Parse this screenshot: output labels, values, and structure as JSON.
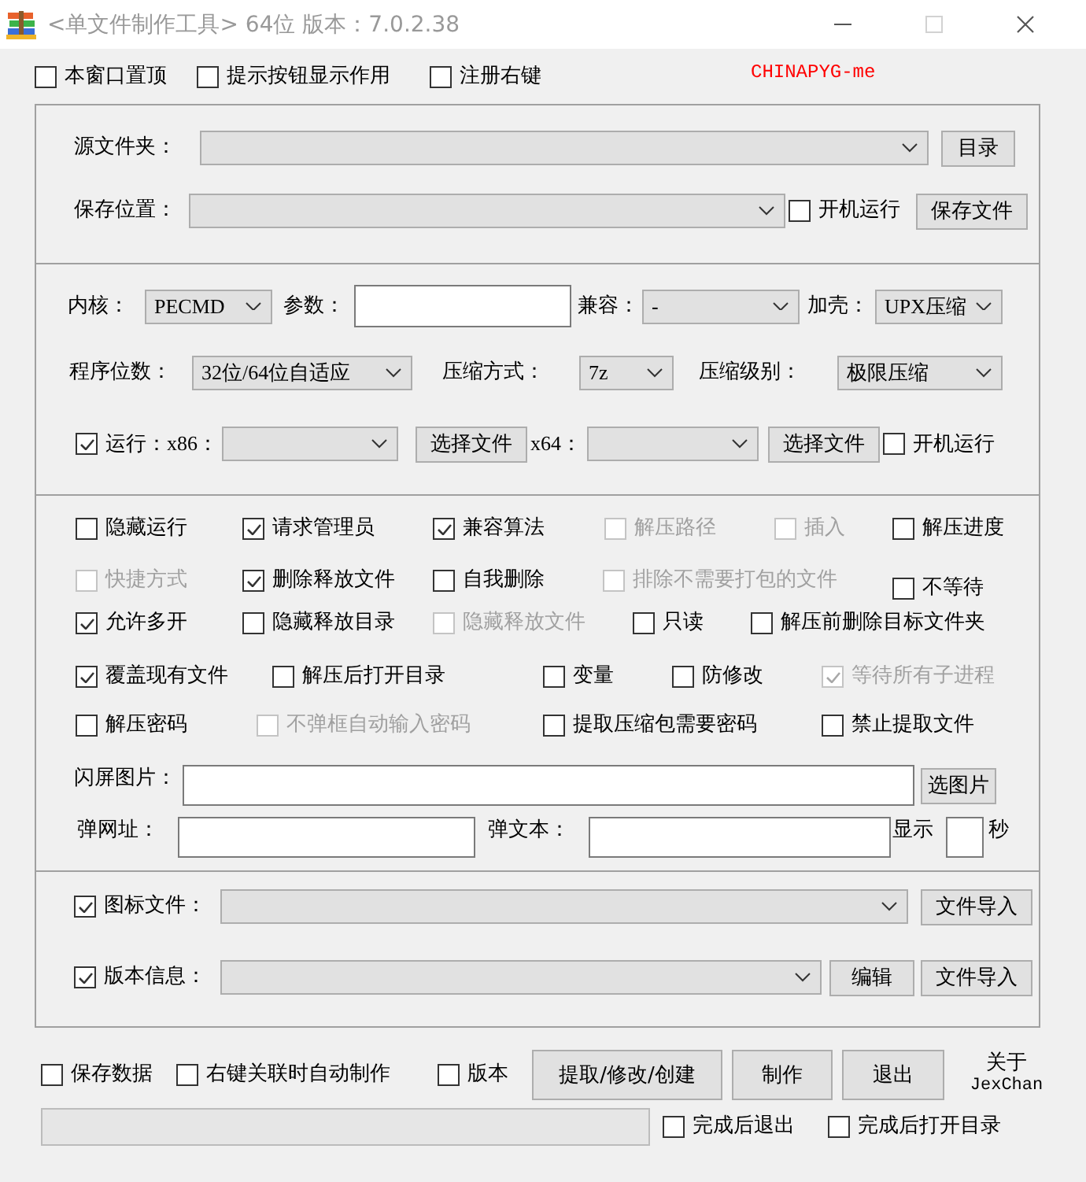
{
  "window": {
    "title": "<单文件制作工具> 64位 版本：7.0.2.38",
    "controls": [
      {
        "kind": "minimize",
        "disabled": false
      },
      {
        "kind": "maximize",
        "disabled": true
      },
      {
        "kind": "close",
        "disabled": false
      }
    ]
  },
  "top_bar": {
    "options": [
      {
        "label": "本窗口置顶",
        "checked": false,
        "disabled": false
      },
      {
        "label": "提示按钮显示作用",
        "checked": false,
        "disabled": false
      },
      {
        "label": "注册右键",
        "checked": false,
        "disabled": false
      }
    ],
    "tag": "CHINAPYG-me"
  },
  "panel": {
    "sections": [
      {
        "rows": [
          {
            "items": [
              {
                "kind": "label",
                "text": "源文件夹："
              },
              {
                "kind": "dropdown"
              },
              {
                "kind": "button",
                "label": "目录"
              }
            ]
          },
          {
            "items": [
              {
                "kind": "label",
                "text": "保存位置："
              },
              {
                "kind": "dropdown"
              },
              {
                "kind": "checkbox",
                "label": "开机运行",
                "checked": false,
                "disabled": false
              },
              {
                "kind": "button",
                "label": "保存文件"
              }
            ]
          }
        ]
      },
      {
        "rows": [
          {
            "items": [
              {
                "kind": "label",
                "text": "内核："
              },
              {
                "kind": "dropdown",
                "value": "PECMD"
              },
              {
                "kind": "label",
                "text": "参数："
              },
              {
                "kind": "input"
              },
              {
                "kind": "label",
                "text": "兼容："
              },
              {
                "kind": "dropdown",
                "value": "-"
              },
              {
                "kind": "label",
                "text": "加壳："
              },
              {
                "kind": "dropdown",
                "value": "UPX压缩"
              }
            ]
          },
          {
            "items": [
              {
                "kind": "label",
                "text": "程序位数："
              },
              {
                "kind": "dropdown",
                "value": "32位/64位自适应"
              },
              {
                "kind": "label",
                "text": "压缩方式："
              },
              {
                "kind": "dropdown",
                "value": "7z"
              },
              {
                "kind": "label",
                "text": "压缩级别："
              },
              {
                "kind": "dropdown",
                "value": "极限压缩"
              }
            ]
          },
          {
            "items": [
              {
                "kind": "checkbox",
                "label": "运行：x86：",
                "checked": true,
                "disabled": false
              },
              {
                "kind": "dropdown"
              },
              {
                "kind": "button",
                "label": "选择文件"
              },
              {
                "kind": "label",
                "text": "x64："
              },
              {
                "kind": "dropdown"
              },
              {
                "kind": "button",
                "label": "选择文件"
              },
              {
                "kind": "checkbox",
                "label": "开机运行",
                "checked": false,
                "disabled": false
              }
            ]
          }
        ]
      },
      {
        "rows": [
          {
            "items": [
              {
                "kind": "checkbox",
                "label": "隐藏运行",
                "checked": false,
                "disabled": false
              },
              {
                "kind": "checkbox",
                "label": "请求管理员",
                "checked": true,
                "disabled": false
              },
              {
                "kind": "checkbox",
                "label": "兼容算法",
                "checked": true,
                "disabled": false
              },
              {
                "kind": "checkbox",
                "label": "解压路径",
                "checked": false,
                "disabled": true
              },
              {
                "kind": "checkbox",
                "label": "插入",
                "checked": false,
                "disabled": true
              },
              {
                "kind": "checkbox",
                "label": "解压进度",
                "checked": false,
                "disabled": false
              }
            ]
          },
          {
            "items": [
              {
                "kind": "checkbox",
                "label": "快捷方式",
                "checked": false,
                "disabled": true
              },
              {
                "kind": "checkbox",
                "label": "删除释放文件",
                "checked": true,
                "disabled": false
              },
              {
                "kind": "checkbox",
                "label": "自我删除",
                "checked": false,
                "disabled": false
              },
              {
                "kind": "checkbox",
                "label": "排除不需要打包的文件",
                "checked": false,
                "disabled": true
              },
              {
                "kind": "checkbox",
                "label": "不等待",
                "checked": false,
                "disabled": false
              }
            ]
          },
          {
            "items": [
              {
                "kind": "checkbox",
                "label": "允许多开",
                "checked": true,
                "disabled": false
              },
              {
                "kind": "checkbox",
                "label": "隐藏释放目录",
                "checked": false,
                "disabled": false
              },
              {
                "kind": "checkbox",
                "label": "隐藏释放文件",
                "checked": false,
                "disabled": true
              },
              {
                "kind": "checkbox",
                "label": "只读",
                "checked": false,
                "disabled": false
              },
              {
                "kind": "checkbox",
                "label": "解压前删除目标文件夹",
                "checked": false,
                "disabled": false
              }
            ]
          },
          {
            "items": [
              {
                "kind": "checkbox",
                "label": "覆盖现有文件",
                "checked": true,
                "disabled": false
              },
              {
                "kind": "checkbox",
                "label": "解压后打开目录",
                "checked": false,
                "disabled": false
              },
              {
                "kind": "checkbox",
                "label": "变量",
                "checked": false,
                "disabled": false
              },
              {
                "kind": "checkbox",
                "label": "防修改",
                "checked": false,
                "disabled": false
              },
              {
                "kind": "checkbox",
                "label": "等待所有子进程",
                "checked": true,
                "disabled": true
              }
            ]
          },
          {
            "items": [
              {
                "kind": "checkbox",
                "label": "解压密码",
                "checked": false,
                "disabled": false
              },
              {
                "kind": "checkbox",
                "label": "不弹框自动输入密码",
                "checked": false,
                "disabled": true
              },
              {
                "kind": "checkbox",
                "label": "提取压缩包需要密码",
                "checked": false,
                "disabled": false
              },
              {
                "kind": "checkbox",
                "label": "禁止提取文件",
                "checked": false,
                "disabled": false
              }
            ]
          },
          {
            "items": [
              {
                "kind": "label",
                "text": "闪屏图片："
              },
              {
                "kind": "input"
              },
              {
                "kind": "button",
                "label": "选图片"
              }
            ]
          },
          {
            "items": [
              {
                "kind": "label",
                "text": "弹网址："
              },
              {
                "kind": "input"
              },
              {
                "kind": "label",
                "text": "弹文本："
              },
              {
                "kind": "input"
              },
              {
                "kind": "label",
                "text": "显示"
              },
              {
                "kind": "input"
              },
              {
                "kind": "label",
                "text": "秒"
              }
            ]
          }
        ]
      },
      {
        "rows": [
          {
            "items": [
              {
                "kind": "checkbox",
                "label": "图标文件：",
                "checked": true,
                "disabled": false
              },
              {
                "kind": "dropdown"
              },
              {
                "kind": "button",
                "label": "文件导入"
              }
            ]
          },
          {
            "items": [
              {
                "kind": "checkbox",
                "label": "版本信息：",
                "checked": true,
                "disabled": false
              },
              {
                "kind": "dropdown"
              },
              {
                "kind": "button",
                "label": "编辑"
              },
              {
                "kind": "button",
                "label": "文件导入"
              }
            ]
          }
        ]
      }
    ]
  },
  "footer": {
    "rows": [
      {
        "items": [
          {
            "kind": "checkbox",
            "label": "保存数据",
            "checked": false,
            "disabled": false
          },
          {
            "kind": "checkbox",
            "label": "右键关联时自动制作",
            "checked": false,
            "disabled": false
          },
          {
            "kind": "checkbox",
            "label": "版本",
            "checked": false,
            "disabled": false
          },
          {
            "kind": "button",
            "label": "提取/修改/创建"
          },
          {
            "kind": "button",
            "label": "制作"
          },
          {
            "kind": "button",
            "label": "退出"
          },
          {
            "kind": "caption",
            "lines": [
              "关于",
              "JexChan"
            ]
          }
        ]
      },
      {
        "items": [
          {
            "kind": "progress",
            "level": 0
          },
          {
            "kind": "checkbox",
            "label": "完成后退出",
            "checked": false,
            "disabled": false
          },
          {
            "kind": "checkbox",
            "label": "完成后打开目录",
            "checked": false,
            "disabled": false
          }
        ]
      }
    ]
  }
}
